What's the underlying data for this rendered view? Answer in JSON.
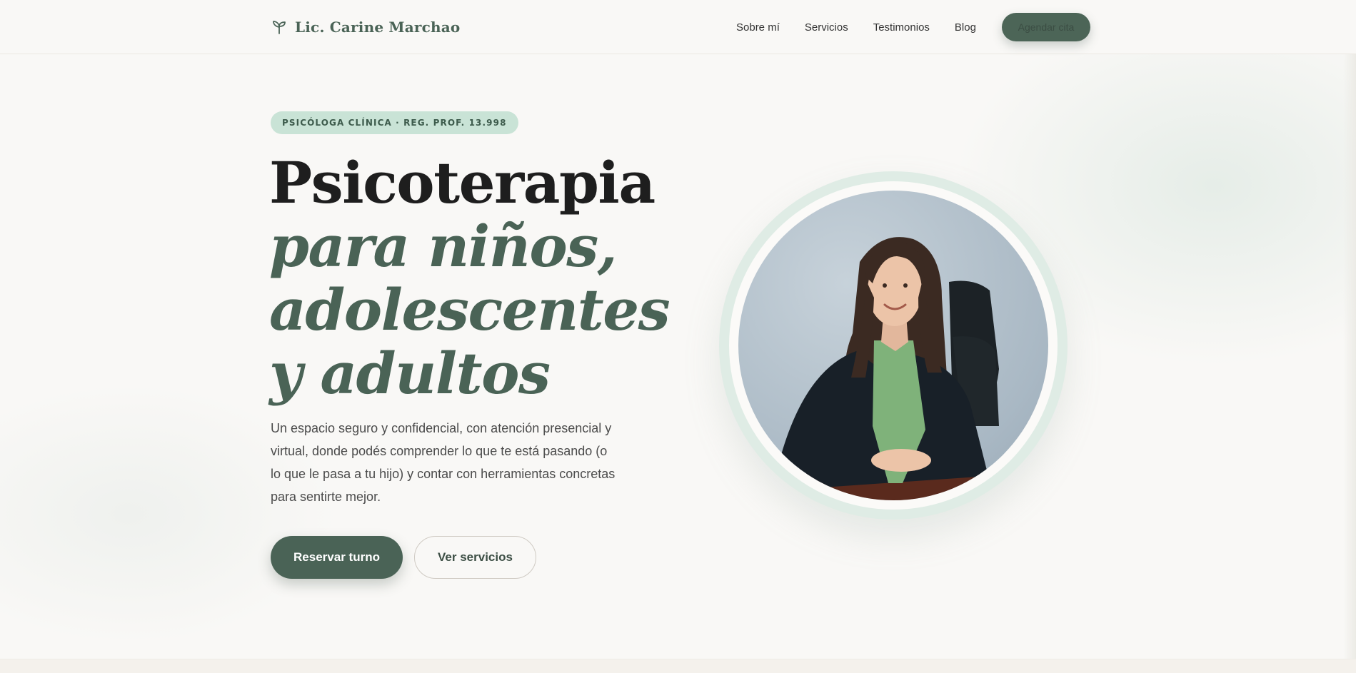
{
  "header": {
    "brand_name": "Lic. Carine Marchao",
    "brand_icon": "sprout-icon",
    "nav": [
      {
        "label": "Sobre mí"
      },
      {
        "label": "Servicios"
      },
      {
        "label": "Testimonios"
      },
      {
        "label": "Blog"
      }
    ],
    "cta_label": "Agendar cita"
  },
  "hero": {
    "badge": "PSICÓLOGA CLÍNICA · REG. PROF. 13.998",
    "title_line1": "Psicoterapia",
    "title_line2": "para niños,",
    "title_line3": "adolescentes",
    "title_line4": "y adultos",
    "intro": "Un espacio seguro y confidencial, con atención presencial y virtual, donde podés comprender lo que te está pasando (o lo que le pasa a tu hijo) y contar con herramientas concretas para sentirte mejor.",
    "primary_button": "Reservar turno",
    "secondary_button": "Ver servicios"
  },
  "colors": {
    "accent": "#4a6356",
    "badge_bg": "#c9e3d6",
    "background": "#f9f8f6",
    "ring": "#dfece5"
  }
}
